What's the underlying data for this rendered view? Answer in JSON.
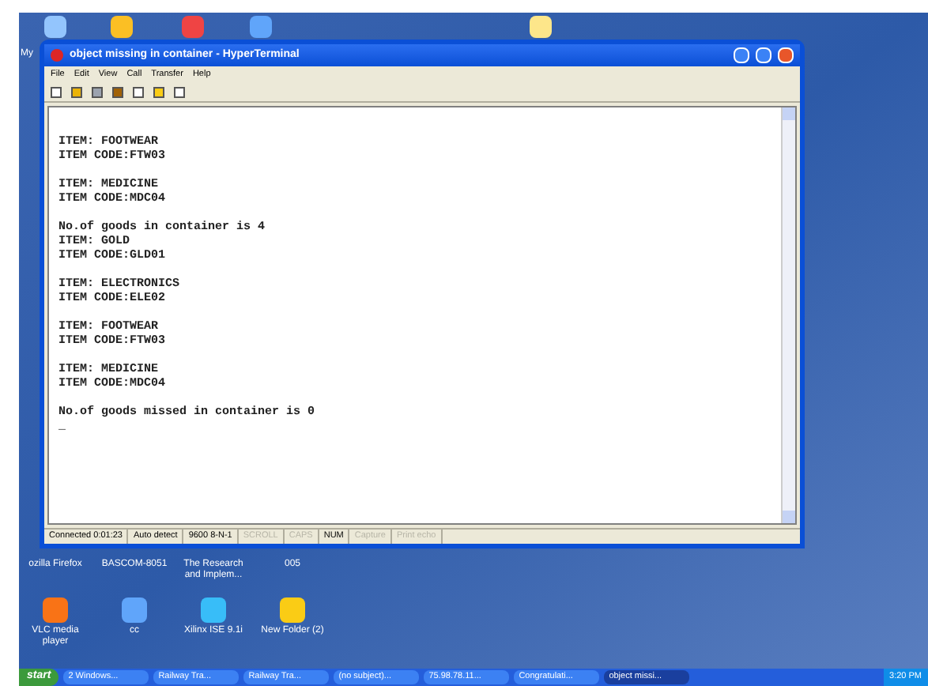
{
  "window": {
    "title": "object missing in container - HyperTerminal"
  },
  "menu": [
    "File",
    "Edit",
    "View",
    "Call",
    "Transfer",
    "Help"
  ],
  "terminal": {
    "blocks": [
      {
        "lines": [
          "ITEM: FOOTWEAR",
          "ITEM CODE:FTW03"
        ]
      },
      {
        "lines": [
          "ITEM: MEDICINE",
          "ITEM CODE:MDC04"
        ]
      },
      {
        "lines": [
          "No.of goods in container is 4",
          "ITEM: GOLD",
          "ITEM CODE:GLD01"
        ]
      },
      {
        "lines": [
          "ITEM: ELECTRONICS",
          "ITEM CODE:ELE02"
        ]
      },
      {
        "lines": [
          "ITEM: FOOTWEAR",
          "ITEM CODE:FTW03"
        ]
      },
      {
        "lines": [
          "ITEM: MEDICINE",
          "ITEM CODE:MDC04"
        ]
      },
      {
        "lines": [
          "No.of goods missed in container is 0",
          "_"
        ]
      }
    ]
  },
  "status_bar": [
    {
      "text": "Connected 0:01:23",
      "disabled": false
    },
    {
      "text": "Auto detect",
      "disabled": false
    },
    {
      "text": "9600 8-N-1",
      "disabled": false
    },
    {
      "text": "SCROLL",
      "disabled": true
    },
    {
      "text": "CAPS",
      "disabled": true
    },
    {
      "text": "NUM",
      "disabled": false
    },
    {
      "text": "Capture",
      "disabled": true
    },
    {
      "text": "Print echo",
      "disabled": true
    }
  ],
  "desktop_labels": [
    "My",
    "ozilla Firefox",
    "BASCOM-8051",
    "The Research and Implem...",
    "005"
  ],
  "desktop_icons": [
    {
      "label": "VLC media player"
    },
    {
      "label": "cc"
    },
    {
      "label": "Xilinx ISE 9.1i"
    },
    {
      "label": "New Folder (2)"
    }
  ],
  "taskbar": {
    "start": "start",
    "items": [
      {
        "label": "2 Windows...",
        "selected": false
      },
      {
        "label": "Railway Tra...",
        "selected": false
      },
      {
        "label": "Railway Tra...",
        "selected": false
      },
      {
        "label": "(no subject)...",
        "selected": false
      },
      {
        "label": "75.98.78.11...",
        "selected": false
      },
      {
        "label": "Congratulati...",
        "selected": false
      },
      {
        "label": "object missi...",
        "selected": true
      }
    ],
    "clock": "3:20 PM"
  }
}
